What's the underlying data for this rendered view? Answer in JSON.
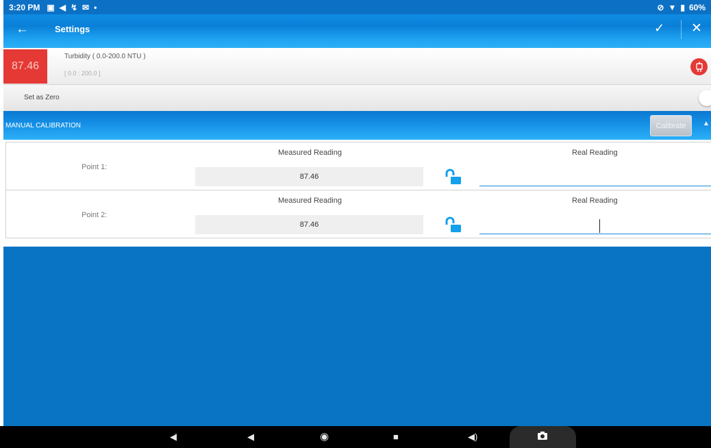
{
  "status_bar": {
    "time": "3:20 PM",
    "battery": "60%"
  },
  "title_bar": {
    "title": "Settings"
  },
  "sensor": {
    "reading": "87.46",
    "name": "Turbidity ( 0.0-200.0 NTU )",
    "range": "[ 0.0 : 200.0 ]",
    "reading_bg": "#e53935"
  },
  "zero": {
    "label": "Set as Zero",
    "enabled": false
  },
  "calibration": {
    "header": "MANUAL CALIBRATION",
    "calibrate_label": "Calibrate",
    "points": [
      {
        "label": "Point 1:",
        "measured_label": "Measured Reading",
        "measured_value": "87.46",
        "real_label": "Real Reading",
        "real_value": ""
      },
      {
        "label": "Point 2:",
        "measured_label": "Measured Reading",
        "measured_value": "87.46",
        "real_label": "Real Reading",
        "real_value": ""
      }
    ]
  },
  "icons": {
    "back": "arrow-left-icon",
    "confirm": "check-icon",
    "close": "close-icon",
    "probe": "probe-icon",
    "lock": "unlocked-padlock-icon",
    "collapse": "chevron-up-icon"
  },
  "colors": {
    "primary_blue": "#0a74c4",
    "accent_red": "#e53935",
    "lock_blue": "#14a0ea"
  }
}
